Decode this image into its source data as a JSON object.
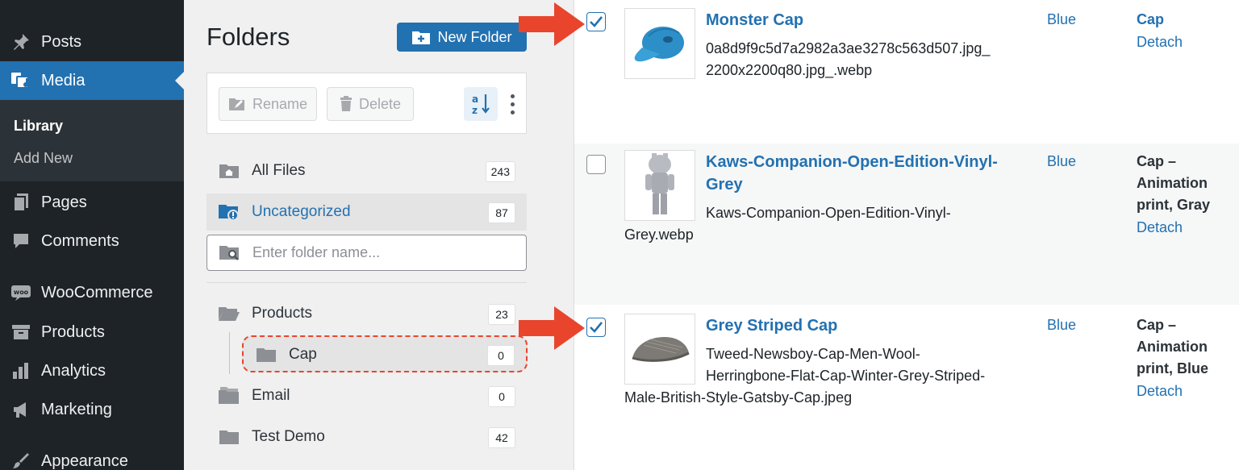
{
  "sidebar": {
    "items": [
      {
        "label": "Posts",
        "icon": "pushpin-icon"
      },
      {
        "label": "Media",
        "icon": "media-icon"
      },
      {
        "label": "Pages",
        "icon": "pages-icon"
      },
      {
        "label": "Comments",
        "icon": "comment-icon"
      },
      {
        "label": "WooCommerce",
        "icon": "woocommerce-icon"
      },
      {
        "label": "Products",
        "icon": "archive-icon"
      },
      {
        "label": "Analytics",
        "icon": "bar-chart-icon"
      },
      {
        "label": "Marketing",
        "icon": "megaphone-icon"
      },
      {
        "label": "Appearance",
        "icon": "paintbrush-icon"
      }
    ],
    "submenu": {
      "library": "Library",
      "add_new": "Add New"
    }
  },
  "folders": {
    "title": "Folders",
    "new_folder": "New Folder",
    "rename": "Rename",
    "delete": "Delete",
    "search_placeholder": "Enter folder name...",
    "rows": [
      {
        "label": "All Files",
        "count": "243"
      },
      {
        "label": "Uncategorized",
        "count": "87"
      },
      {
        "label": "Products",
        "count": "23"
      },
      {
        "label": "Cap",
        "count": "0"
      },
      {
        "label": "Email",
        "count": "0"
      },
      {
        "label": "Test Demo",
        "count": "42"
      }
    ]
  },
  "media": [
    {
      "title": "Monster Cap",
      "file_line1": "0a8d9f9c5d7a2982a3ae3278c563d507.jpg_",
      "file_line2": "2200x2200q80.jpg_.webp",
      "color": "Blue",
      "parent": "Cap",
      "detach": "Detach",
      "checked": true
    },
    {
      "title_line1": "Kaws-Companion-Open-Edition-Vinyl-",
      "title_line2": "Grey",
      "file_line1": "Kaws-Companion-Open-Edition-Vinyl-",
      "file_line2": "Grey.webp",
      "color": "Blue",
      "parent_line1": "Cap –",
      "parent_line2": "Animation",
      "parent_line3": "print, Gray",
      "detach": "Detach",
      "checked": false
    },
    {
      "title": "Grey Striped Cap",
      "file_line1": "Tweed-Newsboy-Cap-Men-Wool-",
      "file_line2": "Herringbone-Flat-Cap-Winter-Grey-Striped-",
      "file_line3": "Male-British-Style-Gatsby-Cap.jpeg",
      "color": "Blue",
      "parent_line1": "Cap –",
      "parent_line2": "Animation",
      "parent_line3": "print, Blue",
      "detach": "Detach",
      "checked": true
    }
  ],
  "colors": {
    "accent": "#2271b1",
    "sidebar": "#1d2327",
    "arrow": "#e8452c"
  }
}
